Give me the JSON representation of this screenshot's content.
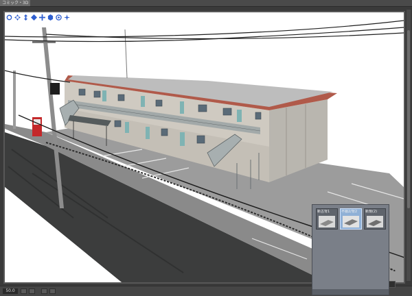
{
  "app": {
    "tab_title": "コミック・3D"
  },
  "toolbar": {
    "tools": [
      {
        "name": "camera-rotate-icon",
        "glyph": "⟳"
      },
      {
        "name": "camera-pan-icon",
        "glyph": "✥"
      },
      {
        "name": "camera-move-icon",
        "glyph": "⇕"
      },
      {
        "name": "object-rotate-icon",
        "glyph": "◇"
      },
      {
        "name": "object-move-icon",
        "glyph": "✛"
      },
      {
        "name": "object-scale-icon",
        "glyph": "⬡"
      },
      {
        "name": "reset-icon",
        "glyph": "◎"
      },
      {
        "name": "view-toggle-icon",
        "glyph": "✲"
      }
    ],
    "accent": "#2f5fd0"
  },
  "status": {
    "zoom": "50.0"
  },
  "preset_panel": {
    "items": [
      {
        "label": "新古背1",
        "selected": false
      },
      {
        "label": "不揃2/背2",
        "selected": true
      },
      {
        "label": "新規(2)",
        "selected": false
      }
    ]
  },
  "scene": {
    "subject": "two-story apartment building 3D model",
    "roof_color": "#b05a4a"
  }
}
